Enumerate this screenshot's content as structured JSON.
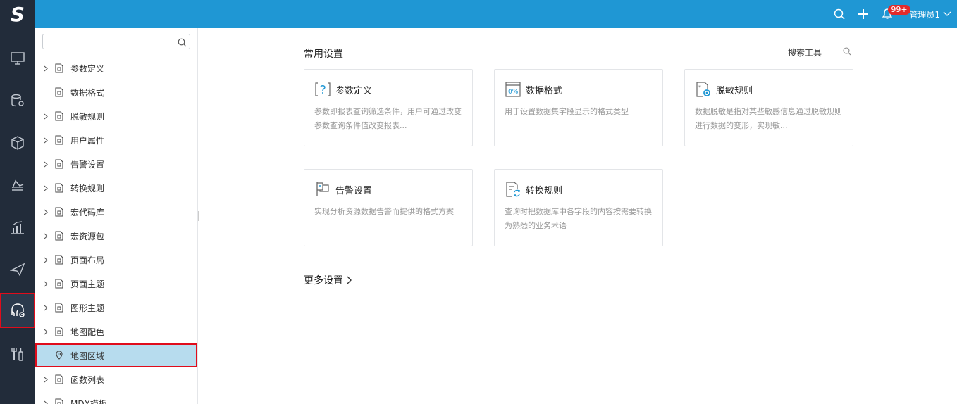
{
  "header": {
    "logo_text": "S",
    "notification_count": "99+",
    "user_name": "管理员1",
    "bg_color": "#1f97d4"
  },
  "sidenav": {
    "items": [
      {
        "icon": "monitor-icon"
      },
      {
        "icon": "database-gear-icon"
      },
      {
        "icon": "cube-icon"
      },
      {
        "icon": "dashboard-icon"
      },
      {
        "icon": "bar-chart-icon"
      },
      {
        "icon": "send-icon"
      },
      {
        "icon": "settings-headset-icon",
        "active": true
      },
      {
        "icon": "tools-icon"
      }
    ]
  },
  "tree": {
    "search_placeholder": "",
    "items": [
      {
        "label": "参数定义",
        "icon": "param-icon",
        "has_arrow": true
      },
      {
        "label": "数据格式",
        "icon": "format-icon",
        "has_arrow": false
      },
      {
        "label": "脱敏规则",
        "icon": "mask-icon",
        "has_arrow": true
      },
      {
        "label": "用户属性",
        "icon": "user-attr-icon",
        "has_arrow": true
      },
      {
        "label": "告警设置",
        "icon": "flag-icon",
        "has_arrow": true
      },
      {
        "label": "转换规则",
        "icon": "convert-icon",
        "has_arrow": true
      },
      {
        "label": "宏代码库",
        "icon": "macro-icon",
        "has_arrow": true
      },
      {
        "label": "宏资源包",
        "icon": "resource-icon",
        "has_arrow": true
      },
      {
        "label": "页面布局",
        "icon": "layout-icon",
        "has_arrow": true
      },
      {
        "label": "页面主题",
        "icon": "theme-icon",
        "has_arrow": true
      },
      {
        "label": "图形主题",
        "icon": "chart-theme-icon",
        "has_arrow": true
      },
      {
        "label": "地图配色",
        "icon": "palette-icon",
        "has_arrow": true
      },
      {
        "label": "地图区域",
        "icon": "location-icon",
        "has_arrow": false,
        "selected": true
      },
      {
        "label": "函数列表",
        "icon": "function-icon",
        "has_arrow": true
      },
      {
        "label": "MDX模板",
        "icon": "mdx-icon",
        "has_arrow": true
      }
    ]
  },
  "main": {
    "section_title": "常用设置",
    "search_label": "搜索工具",
    "cards": [
      {
        "title": "参数定义",
        "icon": "param-question-icon",
        "desc": "参数即报表查询筛选条件，用户可通过改变参数查询条件值改变报表..."
      },
      {
        "title": "数据格式",
        "icon": "percent-format-icon",
        "desc": "用于设置数据集字段显示的格式类型"
      },
      {
        "title": "脱敏规则",
        "icon": "mask-gear-icon",
        "desc": "数据脱敏是指对某些敏感信息通过脱敏规则进行数据的变形，实现敏..."
      },
      {
        "title": "告警设置",
        "icon": "alert-flag-icon",
        "desc": "实现分析资源数据告警而提供的格式方案"
      },
      {
        "title": "转换规则",
        "icon": "convert-doc-icon",
        "desc": "查询时把数据库中各字段的内容按需要转换为熟悉的业务术语"
      }
    ],
    "more_label": "更多设置"
  }
}
